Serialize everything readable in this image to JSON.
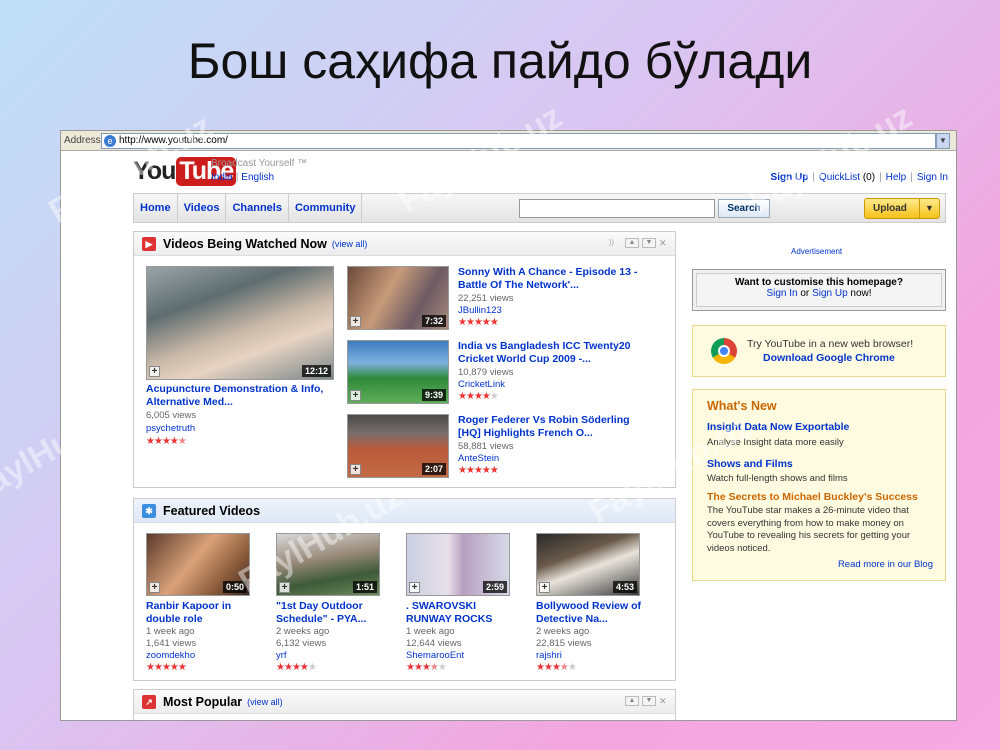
{
  "slide": {
    "title": "Бош саҳифа пайдо бўлади"
  },
  "watermark": "FaylHub.uz",
  "browser": {
    "address_label": "Address",
    "url": "http://www.youtube.com/"
  },
  "header": {
    "logo_you": "You",
    "logo_tube": "Tube",
    "tagline": "Broadcast Yourself ™",
    "region": "India",
    "language": "English",
    "sign_up": "Sign Up",
    "quicklist": "QuickList",
    "quicklist_count": "(0)",
    "help": "Help",
    "sign_in": "Sign In"
  },
  "nav": {
    "tabs": [
      "Home",
      "Videos",
      "Channels",
      "Community"
    ],
    "search_label": "Search",
    "upload_label": "Upload"
  },
  "watched": {
    "title": "Videos Being Watched Now",
    "view_all": "(view all)",
    "main": {
      "title_line1": "Acupuncture Demonstration & Info,",
      "title_line2": "Alternative Med...",
      "views": "6,005 views",
      "user": "psychetruth",
      "duration": "12:12",
      "rating": 4.5
    },
    "items": [
      {
        "title_line1": "Sonny With A Chance - Episode 13 -",
        "title_line2": "Battle Of The Network'...",
        "views": "22,251 views",
        "user": "JBullin123",
        "duration": "7:32",
        "rating": 5
      },
      {
        "title_line1": "India vs Bangladesh ICC Twenty20",
        "title_line2": "Cricket World Cup 2009 -...",
        "views": "10,879 views",
        "user": "CricketLink",
        "duration": "9:39",
        "rating": 4
      },
      {
        "title_line1": "Roger Federer Vs Robin Söderling",
        "title_line2": "[HQ] Highlights French O...",
        "views": "58,881 views",
        "user": "AnteStein",
        "duration": "2:07",
        "rating": 5
      }
    ]
  },
  "featured": {
    "title": "Featured Videos",
    "items": [
      {
        "title_line1": "Ranbir Kapoor in",
        "title_line2": "double role",
        "age": "1 week ago",
        "views": "1,641 views",
        "user": "zoomdekho",
        "duration": "0:50",
        "rating": 5
      },
      {
        "title_line1": "\"1st Day Outdoor",
        "title_line2": "Schedule\" - PYA...",
        "age": "2 weeks ago",
        "views": "6,132 views",
        "user": "yrf",
        "duration": "1:51",
        "rating": 4
      },
      {
        "title_line1": ". SWAROVSKI",
        "title_line2": "RUNWAY ROCKS",
        "age": "1 week ago",
        "views": "12,644 views",
        "user": "ShemarooEnt",
        "duration": "2:59",
        "rating": 3.5
      },
      {
        "title_line1": "Bollywood Review of",
        "title_line2": "Detective Na...",
        "age": "2 weeks ago",
        "views": "22,815 views",
        "user": "rajshri",
        "duration": "4:53",
        "rating": 3.5
      }
    ]
  },
  "popular": {
    "title": "Most Popular",
    "view_all": "(view all)"
  },
  "sidebar": {
    "ad_label": "Advertisement",
    "customise_question": "Want to customise this homepage?",
    "customise_sign_in": "Sign In",
    "customise_or": "or",
    "customise_sign_up": "Sign Up",
    "customise_now": "now!",
    "chrome_line1": "Try YouTube in a new web browser!",
    "chrome_line2": "Download Google Chrome",
    "whats_new_title": "What's New",
    "news": [
      {
        "head": "Insight Data Now Exportable",
        "text": "Analyse Insight data more easily"
      },
      {
        "head": "Shows and Films",
        "text": "Watch full-length shows and films"
      },
      {
        "head": "The Secrets to Michael Buckley's Success",
        "text": "The YouTube star makes a 26-minute video that covers everything from how to make money on YouTube to revealing his secrets for getting your videos noticed."
      }
    ],
    "read_more": "Read more in our Blog"
  }
}
